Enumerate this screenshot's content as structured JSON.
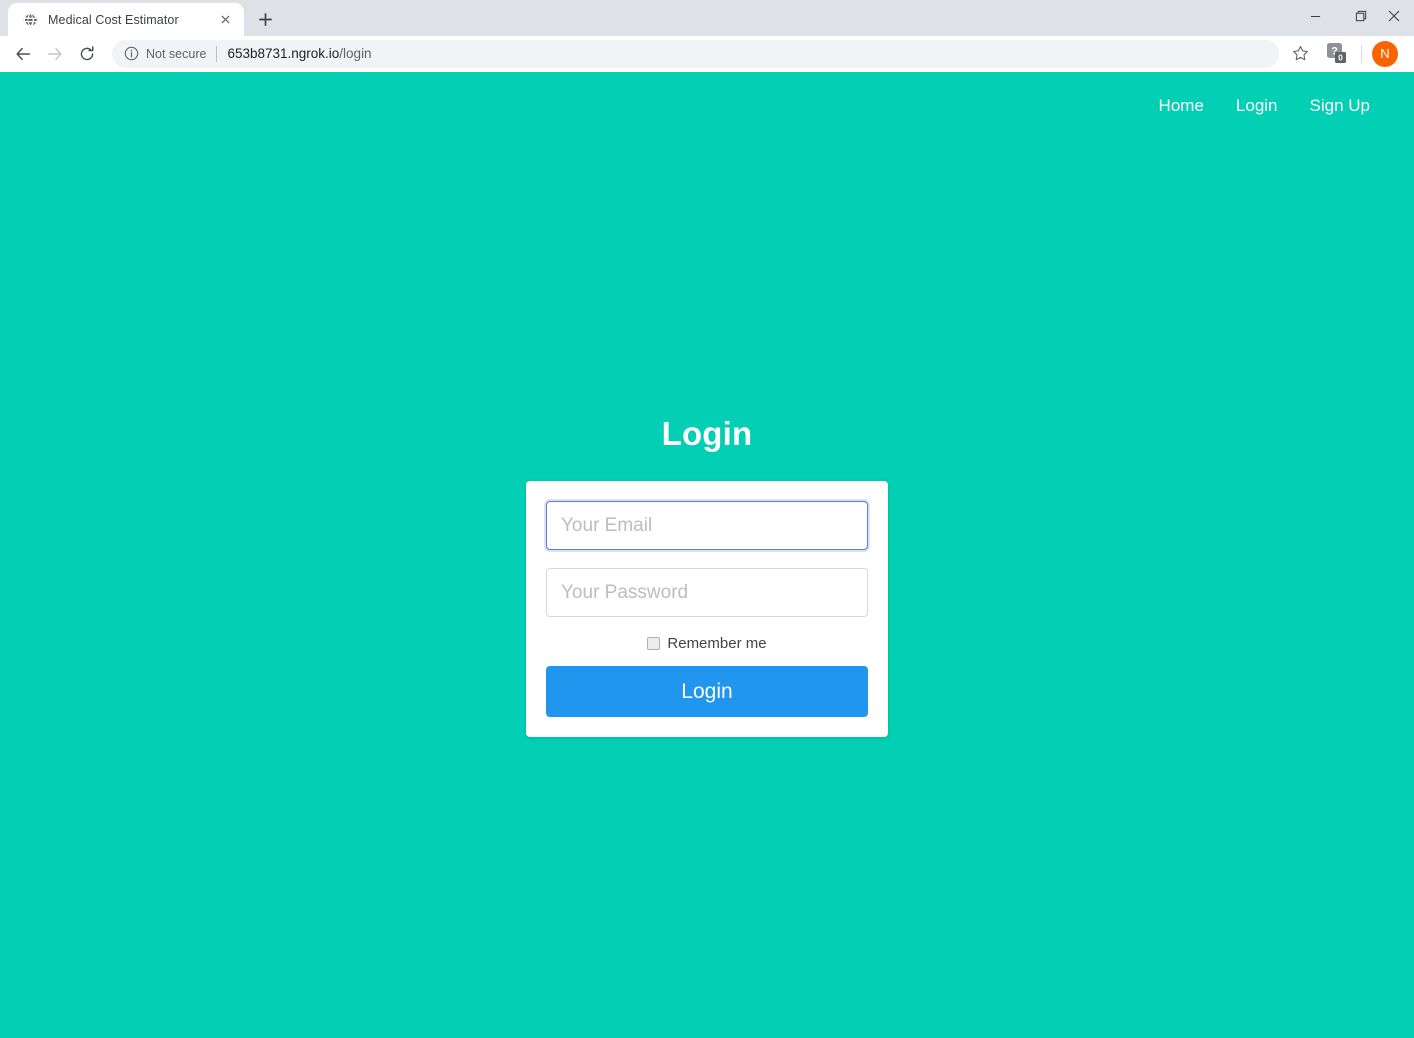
{
  "browser": {
    "tab": {
      "title": "Medical Cost Estimator",
      "favicon": "globe-icon",
      "close_label": "×"
    },
    "new_tab_label": "+",
    "window_controls": {
      "minimize": "—",
      "maximize": "❐",
      "close": "×"
    },
    "nav": {
      "back": "back-arrow-icon",
      "forward": "forward-arrow-icon",
      "reload": "reload-icon"
    },
    "omnibox": {
      "security_icon": "info-circle-icon",
      "security_text": "Not secure",
      "url_host": "653b8731.ngrok.io",
      "url_path": "/login",
      "full_url": "653b8731.ngrok.io/login"
    },
    "bookmark_icon": "star-icon",
    "extension": {
      "icon": "question-mark-extension-icon",
      "badge_count": "0"
    },
    "profile": {
      "initial": "N",
      "color": "#f96400"
    }
  },
  "page": {
    "background_color": "#02cfb4",
    "nav_links": [
      {
        "label": "Home",
        "name": "home"
      },
      {
        "label": "Login",
        "name": "login"
      },
      {
        "label": "Sign Up",
        "name": "signup"
      }
    ],
    "title": "Login",
    "form": {
      "email": {
        "placeholder": "Your Email",
        "value": "",
        "focused": true
      },
      "password": {
        "placeholder": "Your Password",
        "value": "",
        "focused": false
      },
      "remember": {
        "label": "Remember me",
        "checked": false
      },
      "submit": {
        "label": "Login",
        "color": "#2196ef"
      }
    }
  }
}
